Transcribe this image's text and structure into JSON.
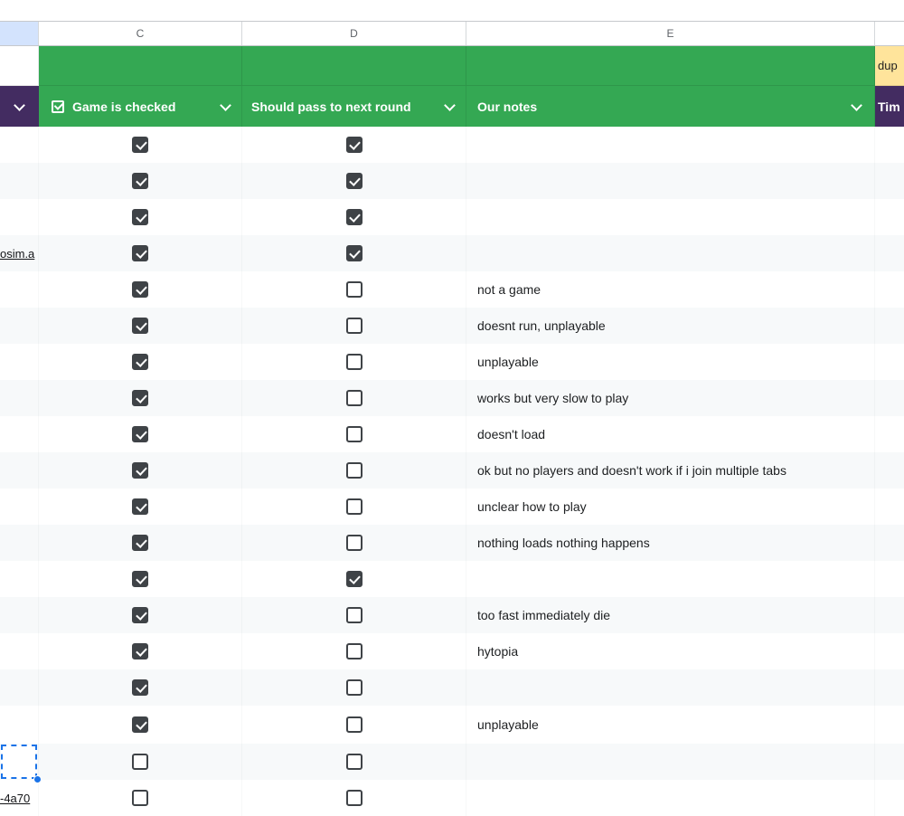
{
  "column_headers": {
    "b": "",
    "c": "C",
    "d": "D",
    "e": "E",
    "f": ""
  },
  "banner_row": {
    "dup_label": "dup"
  },
  "filter_row": {
    "game_checked_label": "Game is checked",
    "pass_label": "Should pass to next round",
    "notes_label": "Our notes",
    "right_label": "Tim"
  },
  "colors": {
    "header_green": "#34a853",
    "header_purple": "#432c61",
    "dup_yellow": "#ffe49b",
    "selection_blue": "#1a73e8",
    "checkbox_dark": "#3f4347",
    "band_gray": "#f7f9fa",
    "column_highlight_blue": "#d3e3fd"
  },
  "rows": [
    {
      "link": "",
      "game_checked": true,
      "pass_next": true,
      "note": "",
      "selected": false
    },
    {
      "link": "",
      "game_checked": true,
      "pass_next": true,
      "note": "",
      "selected": false
    },
    {
      "link": "",
      "game_checked": true,
      "pass_next": true,
      "note": "",
      "selected": false
    },
    {
      "link": "osim.a",
      "game_checked": true,
      "pass_next": true,
      "note": "",
      "selected": false
    },
    {
      "link": "",
      "game_checked": true,
      "pass_next": false,
      "note": "not a game",
      "selected": false
    },
    {
      "link": "",
      "game_checked": true,
      "pass_next": false,
      "note": "doesnt run, unplayable",
      "selected": false
    },
    {
      "link": "",
      "game_checked": true,
      "pass_next": false,
      "note": "unplayable",
      "selected": false
    },
    {
      "link": "",
      "game_checked": true,
      "pass_next": false,
      "note": "works but very slow to play",
      "selected": false
    },
    {
      "link": "",
      "game_checked": true,
      "pass_next": false,
      "note": "doesn't load",
      "selected": false
    },
    {
      "link": "",
      "game_checked": true,
      "pass_next": false,
      "note": "ok but no players and doesn't work if i join multiple tabs",
      "selected": false
    },
    {
      "link": "",
      "game_checked": true,
      "pass_next": false,
      "note": "unclear how to play",
      "selected": false
    },
    {
      "link": "",
      "game_checked": true,
      "pass_next": false,
      "note": "nothing loads nothing happens",
      "selected": false
    },
    {
      "link": "",
      "game_checked": true,
      "pass_next": true,
      "note": "",
      "selected": false
    },
    {
      "link": "",
      "game_checked": true,
      "pass_next": false,
      "note": "too fast immediately die",
      "selected": false
    },
    {
      "link": "",
      "game_checked": true,
      "pass_next": false,
      "note": "hytopia",
      "selected": false
    },
    {
      "link": "",
      "game_checked": true,
      "pass_next": false,
      "note": "",
      "selected": false
    },
    {
      "link": "",
      "game_checked": true,
      "pass_next": false,
      "note": "unplayable",
      "selected": false
    },
    {
      "link": "",
      "game_checked": false,
      "pass_next": false,
      "note": "",
      "selected": true
    },
    {
      "link": "-4a70",
      "game_checked": false,
      "pass_next": false,
      "note": "",
      "selected": false
    }
  ]
}
